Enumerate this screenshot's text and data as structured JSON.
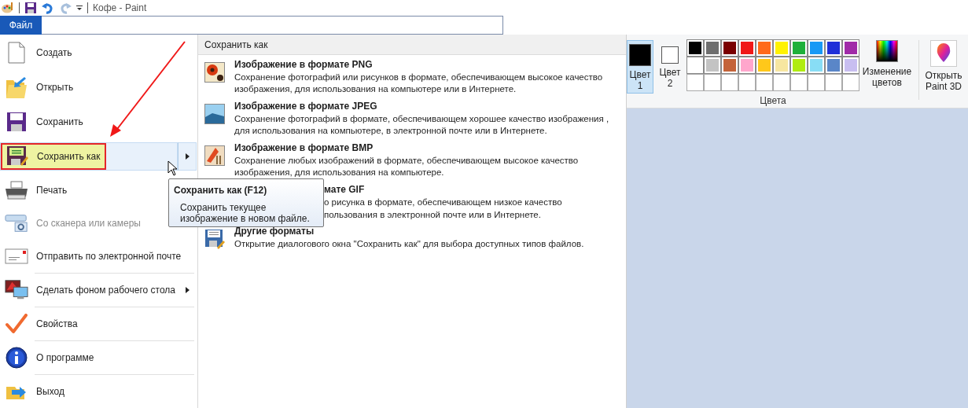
{
  "window": {
    "title": "Кофе - Paint"
  },
  "file_tab": {
    "label": "Файл",
    "selected": true
  },
  "menu": [
    {
      "label": "Создать",
      "selected": false,
      "disabled": false,
      "submenu": false,
      "separator_before": false,
      "highlighted": false
    },
    {
      "label": "Открыть",
      "selected": false,
      "disabled": false,
      "submenu": false,
      "separator_before": false,
      "highlighted": false
    },
    {
      "label": "Сохранить",
      "selected": false,
      "disabled": false,
      "submenu": false,
      "separator_before": false,
      "highlighted": false
    },
    {
      "label": "Сохранить как",
      "selected": true,
      "disabled": false,
      "submenu": true,
      "separator_before": false,
      "highlighted": true
    },
    {
      "label": "Печать",
      "selected": false,
      "disabled": false,
      "submenu": false,
      "separator_before": false,
      "highlighted": false
    },
    {
      "label": "Со сканера или камеры",
      "selected": false,
      "disabled": true,
      "submenu": false,
      "separator_before": false,
      "highlighted": false
    },
    {
      "label": "Отправить по электронной почте",
      "selected": false,
      "disabled": false,
      "submenu": false,
      "separator_before": false,
      "highlighted": false
    },
    {
      "label": "Сделать фоном рабочего стола",
      "selected": false,
      "disabled": false,
      "submenu": true,
      "separator_before": true,
      "highlighted": false
    },
    {
      "label": "Свойства",
      "selected": false,
      "disabled": false,
      "submenu": false,
      "separator_before": true,
      "highlighted": false
    },
    {
      "label": "О программе",
      "selected": false,
      "disabled": false,
      "submenu": false,
      "separator_before": true,
      "highlighted": false
    },
    {
      "label": "Выход",
      "selected": false,
      "disabled": false,
      "submenu": false,
      "separator_before": true,
      "highlighted": false
    }
  ],
  "submenu": {
    "title": "Сохранить как",
    "items": [
      {
        "title": "Изображение в формате PNG",
        "description": "Сохранение фотографий или рисунков в формате, обеспечивающем высокое качество изображения, для использования на компьютере или в Интернете.",
        "covered": false
      },
      {
        "title": "Изображение в формате JPEG",
        "description": "Сохранение фотографий в формате, обеспечивающем хорошее качество изображения , для использования на компьютере, в электронной почте или в Интернете.",
        "covered": false
      },
      {
        "title": "Изображение в формате BMP",
        "description": "Сохранение любых изображений в формате, обеспечивающем высокое качество изображения, для использования на компьютере.",
        "covered": false
      },
      {
        "title": "мате GIF",
        "description_lines": [
          "о рисунка в формате, обеспечивающем низкое качество",
          "пользования в электронной почте или в Интернете."
        ],
        "covered": true
      },
      {
        "title": "Другие форматы",
        "description": "Открытие диалогового окна \"Сохранить как\" для выбора доступных типов файлов.",
        "covered": false
      }
    ]
  },
  "tooltip": {
    "title": "Сохранить как (F12)",
    "text": "Сохранить текущее изображение в новом файле."
  },
  "ribbon": {
    "color_buttons": [
      {
        "label": "Цвет 1",
        "color": "#000000",
        "selected": true
      },
      {
        "label": "Цвет 2",
        "color": "#ffffff",
        "selected": false
      }
    ],
    "palette": [
      {
        "color": "#000000"
      },
      {
        "color": "#6e6e6e"
      },
      {
        "color": "#7a0000"
      },
      {
        "color": "#f01818"
      },
      {
        "color": "#ff6a1a"
      },
      {
        "color": "#fff200"
      },
      {
        "color": "#1fb03a"
      },
      {
        "color": "#1899f5"
      },
      {
        "color": "#2030d8"
      },
      {
        "color": "#a02aa8"
      },
      {
        "color": "#ffffff"
      },
      {
        "color": "#c3c3c3"
      },
      {
        "color": "#c4643a"
      },
      {
        "color": "#ffa6cc"
      },
      {
        "color": "#ffc81a"
      },
      {
        "color": "#f7e6a0"
      },
      {
        "color": "#b0ec10"
      },
      {
        "color": "#88ddf5"
      },
      {
        "color": "#5a86c8"
      },
      {
        "color": "#c8bef0"
      }
    ],
    "edit_colors": "Изменение цветов",
    "group_label": "Цвета",
    "paint3d": "Открыть Paint 3D"
  }
}
